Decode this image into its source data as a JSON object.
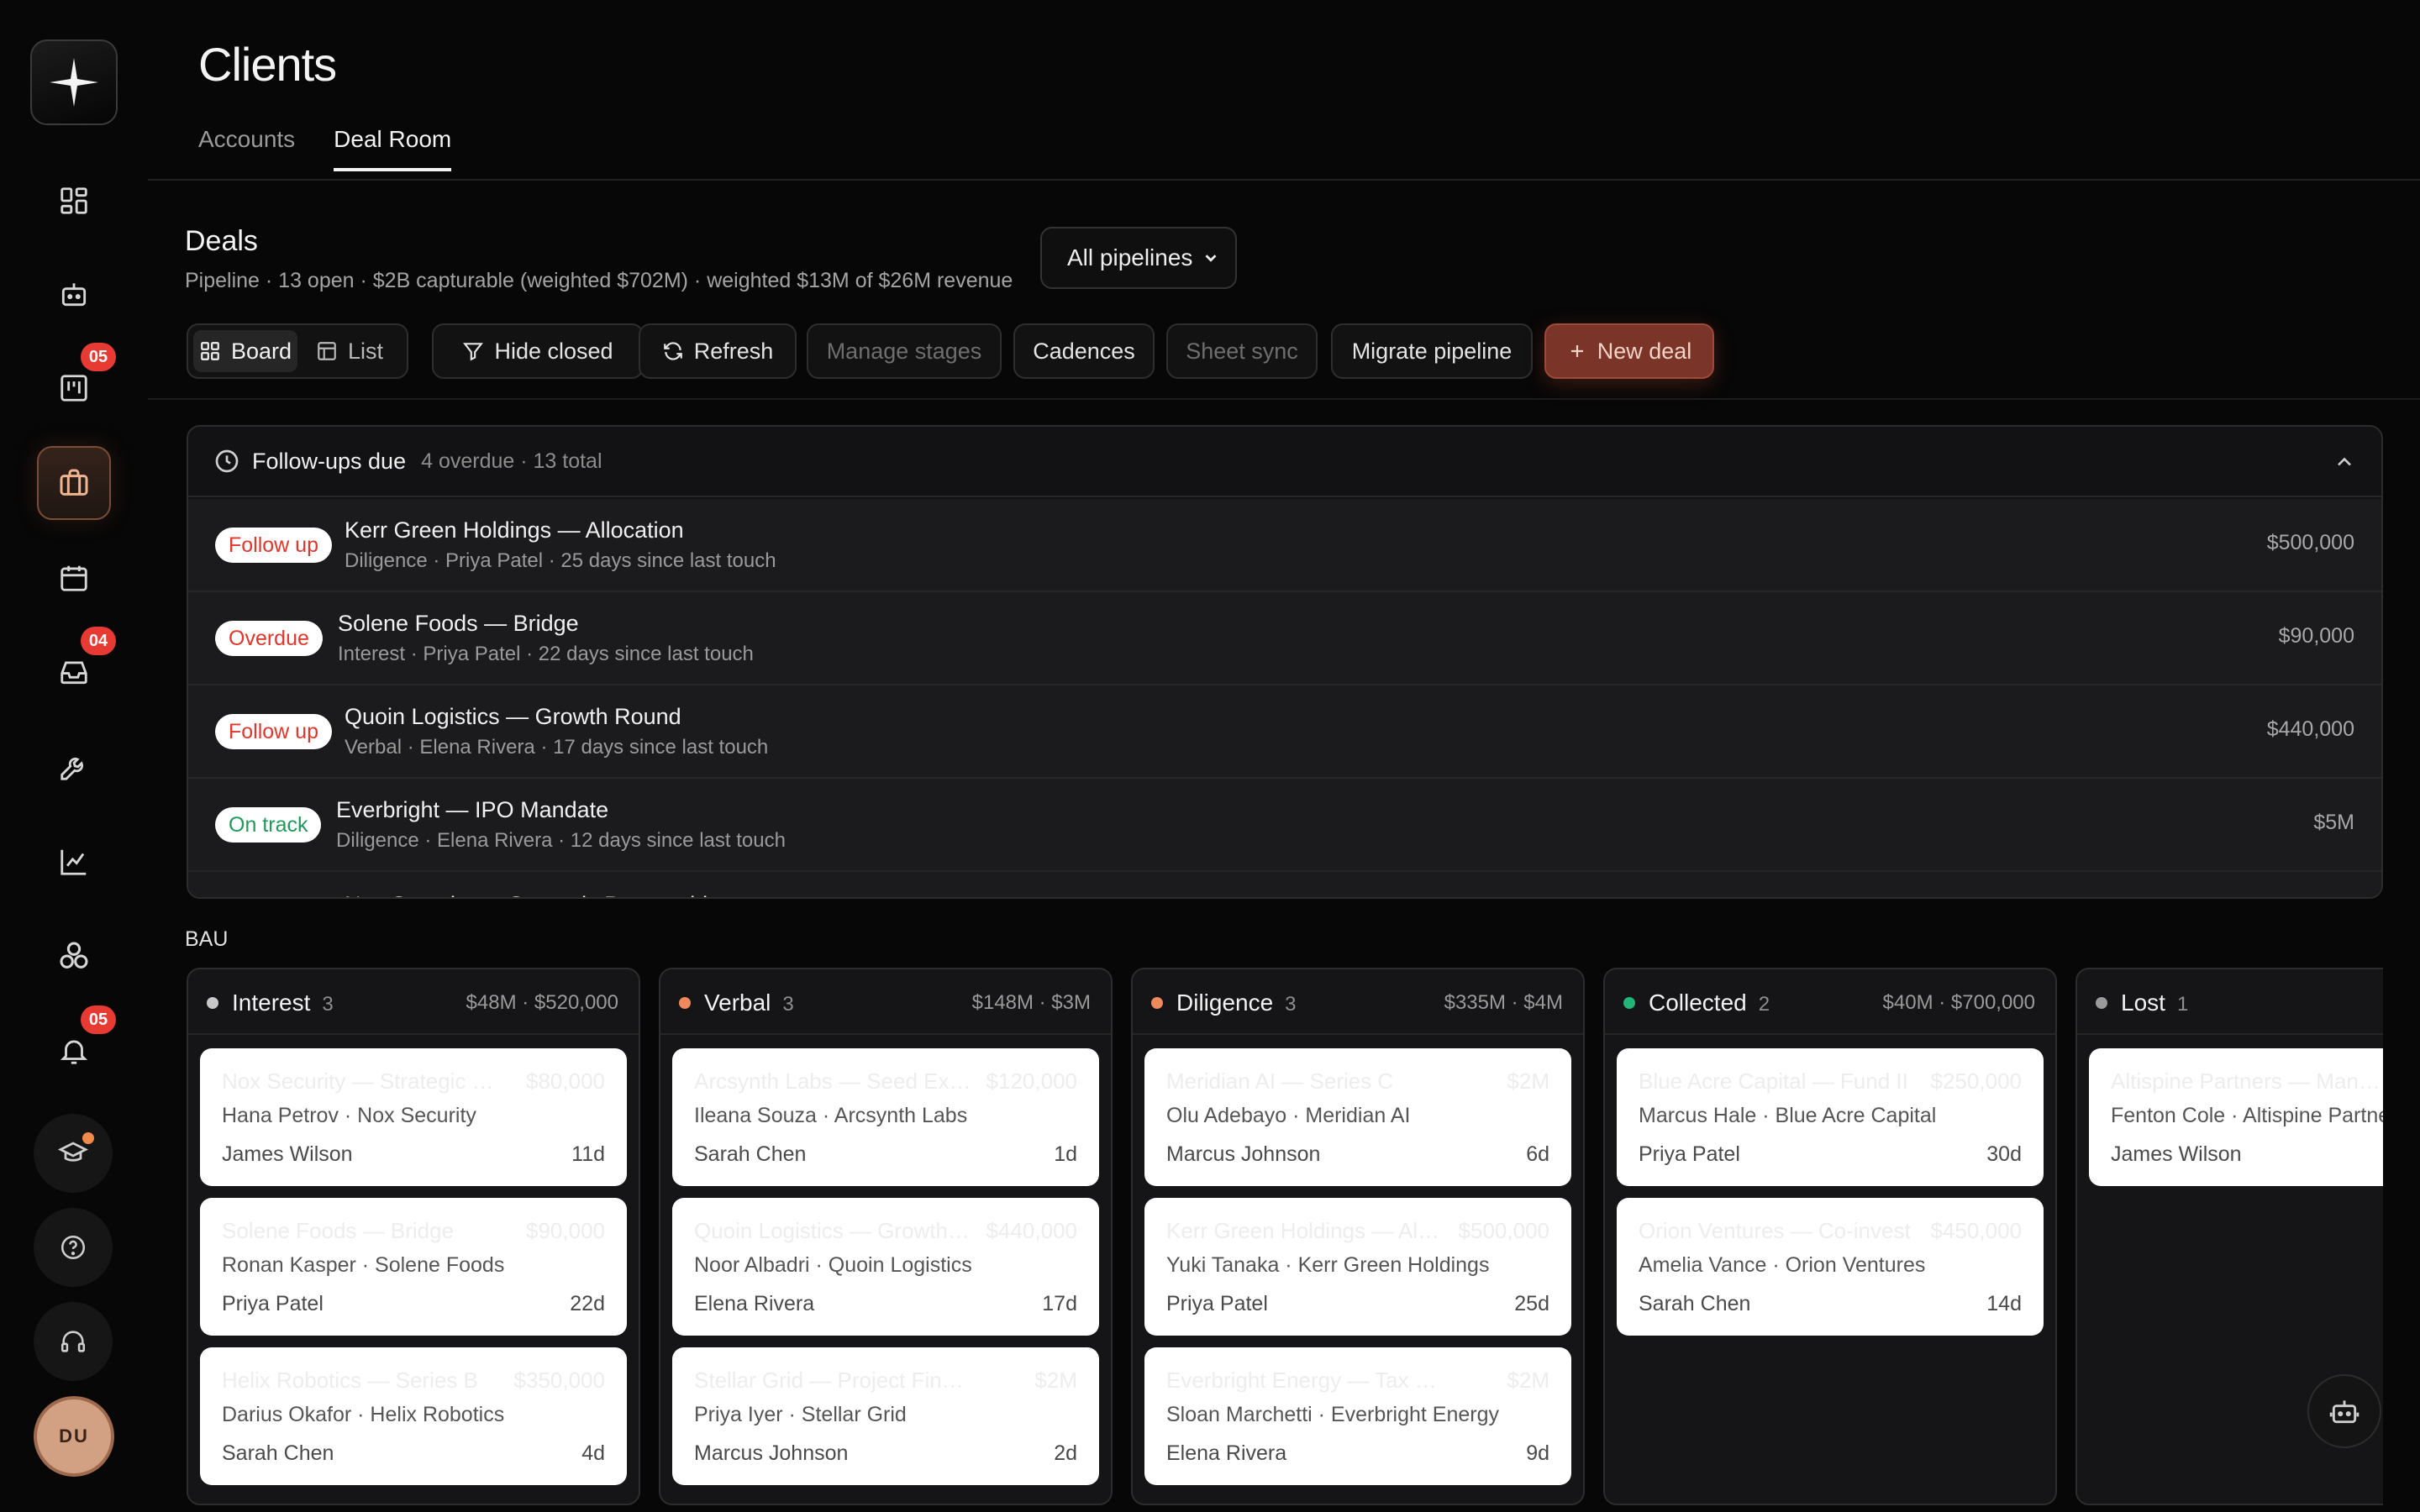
{
  "sidebar": {
    "badges": {
      "tasks": "05",
      "inbox": "04",
      "notifications": "05"
    },
    "avatar_initials": "DU"
  },
  "header": {
    "title": "Clients",
    "tabs": [
      {
        "label": "Accounts"
      },
      {
        "label": "Deal Room"
      }
    ]
  },
  "deals": {
    "title": "Deals",
    "subtitle": "Pipeline · 13 open · $2B capturable (weighted $702M) · weighted $13M of $26M revenue",
    "pipeline_select": "All pipelines"
  },
  "toolbar": {
    "board": "Board",
    "list": "List",
    "hide_closed": "Hide closed",
    "refresh": "Refresh",
    "manage_stages": "Manage stages",
    "cadences": "Cadences",
    "sheet_sync": "Sheet sync",
    "migrate_pipeline": "Migrate pipeline",
    "new_deal": "New deal"
  },
  "followups": {
    "title": "Follow-ups due",
    "meta": "4 overdue · 13 total",
    "rows": [
      {
        "status": "Follow up",
        "name": "Kerr Green Holdings — Allocation",
        "meta": "Diligence · Priya Patel · 25 days since last touch",
        "amount": "$500,000"
      },
      {
        "status": "Overdue",
        "name": "Solene Foods — Bridge",
        "meta": "Interest · Priya Patel · 22 days since last touch",
        "amount": "$90,000"
      },
      {
        "status": "Follow up",
        "name": "Quoin Logistics — Growth Round",
        "meta": "Verbal · Elena Rivera · 17 days since last touch",
        "amount": "$440,000"
      },
      {
        "status": "On track",
        "name": "Everbright — IPO Mandate",
        "meta": "Diligence · Elena Rivera · 12 days since last touch",
        "amount": "$5M"
      },
      {
        "status": "",
        "name": "Nox Security — Strategic Partnership",
        "meta": "",
        "amount": ""
      }
    ]
  },
  "board": {
    "group_label": "BAU",
    "columns": [
      {
        "name": "Interest",
        "count": "3",
        "totals": "$48M · $520,000",
        "dot": "#c8c8c8",
        "cards": [
          {
            "title": "Nox Security — Strategic Partnership",
            "amount": "$80,000",
            "contact": "Hana Petrov · Nox Security",
            "owner": "James Wilson",
            "age": "11d"
          },
          {
            "title": "Solene Foods — Bridge",
            "amount": "$90,000",
            "contact": "Ronan Kasper · Solene Foods",
            "owner": "Priya Patel",
            "age": "22d"
          },
          {
            "title": "Helix Robotics — Series B",
            "amount": "$350,000",
            "contact": "Darius Okafor · Helix Robotics",
            "owner": "Sarah Chen",
            "age": "4d"
          }
        ]
      },
      {
        "name": "Verbal",
        "count": "3",
        "totals": "$148M · $3M",
        "dot": "#f08a5d",
        "cards": [
          {
            "title": "Arcsynth Labs — Seed Extension",
            "amount": "$120,000",
            "contact": "Ileana Souza · Arcsynth Labs",
            "owner": "Sarah Chen",
            "age": "1d"
          },
          {
            "title": "Quoin Logistics — Growth Round",
            "amount": "$440,000",
            "contact": "Noor Albadri · Quoin Logistics",
            "owner": "Elena Rivera",
            "age": "17d"
          },
          {
            "title": "Stellar Grid — Project Finance",
            "amount": "$2M",
            "contact": "Priya Iyer · Stellar Grid",
            "owner": "Marcus Johnson",
            "age": "2d"
          }
        ]
      },
      {
        "name": "Diligence",
        "count": "3",
        "totals": "$335M · $4M",
        "dot": "#f08a5d",
        "cards": [
          {
            "title": "Meridian AI — Series C",
            "amount": "$2M",
            "contact": "Olu Adebayo · Meridian AI",
            "owner": "Marcus Johnson",
            "age": "6d"
          },
          {
            "title": "Kerr Green Holdings — Allocation",
            "amount": "$500,000",
            "contact": "Yuki Tanaka · Kerr Green Holdings",
            "owner": "Priya Patel",
            "age": "25d"
          },
          {
            "title": "Everbright Energy — Tax Equity",
            "amount": "$2M",
            "contact": "Sloan Marchetti · Everbright Energy",
            "owner": "Elena Rivera",
            "age": "9d"
          }
        ]
      },
      {
        "name": "Collected",
        "count": "2",
        "totals": "$40M · $700,000",
        "dot": "#22b57a",
        "cards": [
          {
            "title": "Blue Acre Capital — Fund II",
            "amount": "$250,000",
            "contact": "Marcus Hale · Blue Acre Capital",
            "owner": "Priya Patel",
            "age": "30d"
          },
          {
            "title": "Orion Ventures — Co-invest",
            "amount": "$450,000",
            "contact": "Amelia Vance · Orion Ventures",
            "owner": "Sarah Chen",
            "age": "14d"
          }
        ]
      },
      {
        "name": "Lost",
        "count": "1",
        "totals": "",
        "dot": "#9a9a9a",
        "cards": [
          {
            "title": "Altispine Partners — Mandate",
            "amount": "",
            "contact": "Fenton Cole · Altispine Partners",
            "owner": "James Wilson",
            "age": ""
          }
        ]
      }
    ]
  }
}
